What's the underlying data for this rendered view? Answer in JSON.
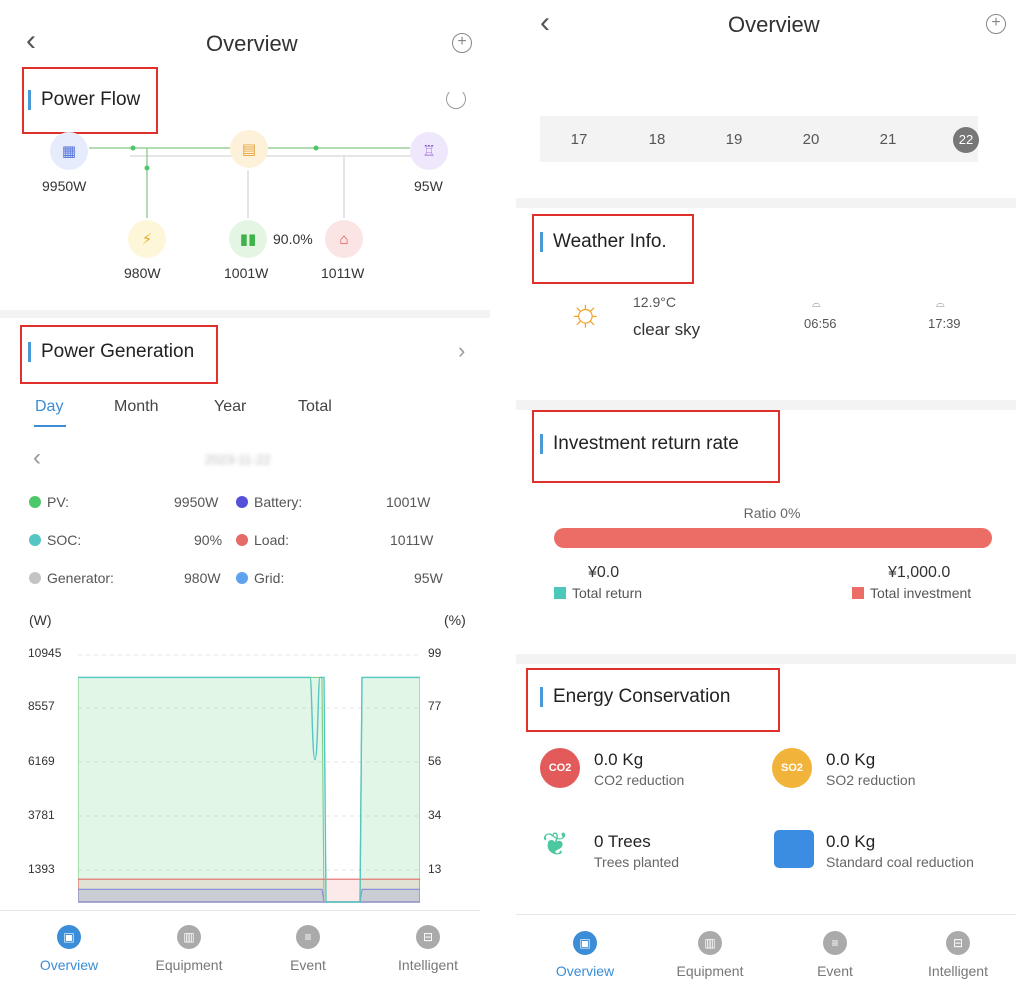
{
  "left": {
    "header": {
      "title": "Overview"
    },
    "power_flow": {
      "title": "Power Flow",
      "pv_value": "9950W",
      "grid_value": "95W",
      "generator_value": "980W",
      "battery_value": "1001W",
      "soc_value": "90.0%",
      "load_value": "1011W"
    },
    "generation": {
      "title": "Power Generation",
      "tabs": [
        "Day",
        "Month",
        "Year",
        "Total"
      ],
      "date": "2023-11-22",
      "legend": [
        {
          "label": "PV:",
          "value": "9950W",
          "color": "#4cc86a"
        },
        {
          "label": "Battery:",
          "value": "1001W",
          "color": "#5550d8"
        },
        {
          "label": "SOC:",
          "value": "90%",
          "color": "#55c6c2"
        },
        {
          "label": "Load:",
          "value": "1011W",
          "color": "#e46b66"
        },
        {
          "label": "Generator:",
          "value": "980W",
          "color": "#c4c4c4"
        },
        {
          "label": "Grid:",
          "value": "95W",
          "color": "#5fa3ee"
        }
      ]
    },
    "chart_data": {
      "type": "area",
      "xlabel": "",
      "ylabel": "(W)",
      "y2label": "(%)",
      "ylim": [
        0,
        10945
      ],
      "yticks": [
        "10945",
        "8557",
        "6169",
        "3781",
        "1393"
      ],
      "y2ticks": [
        "99",
        "77",
        "56",
        "34",
        "13"
      ],
      "series": [
        {
          "name": "PV",
          "values": [
            9950,
            9950,
            9950,
            9950,
            0,
            9950
          ],
          "color": "#4cc86a"
        },
        {
          "name": "SOC",
          "values": [
            90,
            90,
            90,
            57,
            0,
            90
          ],
          "color": "#55c6c2"
        },
        {
          "name": "Load",
          "values": [
            1011,
            1011,
            1011,
            1011,
            1011,
            1011
          ],
          "color": "#e46b66"
        },
        {
          "name": "Battery",
          "values": [
            1001,
            1001,
            1001,
            1001,
            0,
            1001
          ],
          "color": "#5550d8"
        }
      ]
    },
    "nav": [
      "Overview",
      "Equipment",
      "Event",
      "Intelligent"
    ]
  },
  "right": {
    "header": {
      "title": "Overview"
    },
    "calendar": {
      "days": [
        "17",
        "18",
        "19",
        "20",
        "21",
        "22"
      ],
      "selected": "22"
    },
    "weather": {
      "title": "Weather Info.",
      "temp": "12.9°C",
      "desc": "clear sky",
      "sunrise": "06:56",
      "sunset": "17:39"
    },
    "investment": {
      "title": "Investment return rate",
      "ratio": "Ratio 0%",
      "ratio_value": 0,
      "return_value": "¥0.0",
      "return_label": "Total return",
      "invest_value": "¥1,000.0",
      "invest_label": "Total investment",
      "return_color": "#4cc8b8",
      "invest_color": "#ec6c66"
    },
    "energy": {
      "title": "Energy Conservation",
      "co2_value": "0.0 Kg",
      "co2_label": "CO2 reduction",
      "co2_icon": "CO2",
      "so2_value": "0.0 Kg",
      "so2_label": "SO2 reduction",
      "so2_icon": "SO2",
      "trees_value": "0 Trees",
      "trees_label": "Trees planted",
      "coal_value": "0.0 Kg",
      "coal_label": "Standard coal reduction"
    },
    "nav": [
      "Overview",
      "Equipment",
      "Event",
      "Intelligent"
    ]
  }
}
